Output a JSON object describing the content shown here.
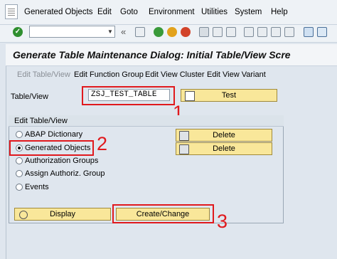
{
  "menu": [
    "Generated Objects",
    "Edit",
    "Goto",
    "Environment",
    "Utilities",
    "System",
    "Help"
  ],
  "toolbar": {
    "back_glyph": "«"
  },
  "title": "Generate Table Maintenance Dialog: Initial Table/View Scre",
  "tabs": [
    "Edit Table/View",
    "Edit Function Group",
    "Edit View Cluster",
    "Edit View Variant"
  ],
  "table_view": {
    "label": "Table/View",
    "value": "ZSJ_TEST_TABLE"
  },
  "buttons": {
    "test": "Test",
    "delete_1": "Delete",
    "delete_2": "Delete",
    "display": "Display",
    "create_change": "Create/Change"
  },
  "group": {
    "title": "Edit Table/View",
    "options": [
      "ABAP Dictionary",
      "Generated Objects",
      "Authorization Groups",
      "Assign Authoriz. Group",
      "Events"
    ],
    "selected": "Generated Objects"
  },
  "annotations": [
    "1",
    "2",
    "3"
  ],
  "colors": {
    "highlight": "#e0191d",
    "button": "#f9e79a",
    "background": "#dfe6ee"
  }
}
